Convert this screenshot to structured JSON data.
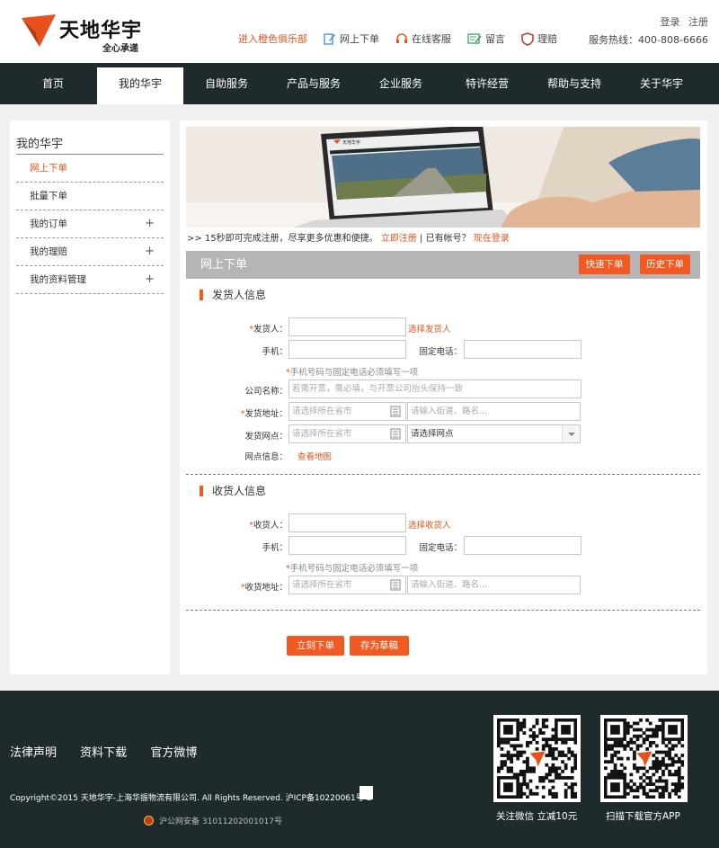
{
  "brand": {
    "name": "天地华宇",
    "slogan": "全心承递",
    "accent": "#f15a22"
  },
  "auth": {
    "login": "登录",
    "register": "注册"
  },
  "top_links": [
    {
      "label": "进入橙色俱乐部",
      "icon": "none"
    },
    {
      "label": "网上下单",
      "icon": "edit-icon"
    },
    {
      "label": "在线客服",
      "icon": "headset-icon"
    },
    {
      "label": "留言",
      "icon": "message-icon"
    },
    {
      "label": "理赔",
      "icon": "shield-icon"
    }
  ],
  "hotline": "服务热线：400-808-6666",
  "nav": [
    "首页",
    "我的华宇",
    "自助服务",
    "产品与服务",
    "企业服务",
    "特许经营",
    "帮助与支持",
    "关于华宇"
  ],
  "nav_active": "我的华宇",
  "sidebar": {
    "title": "我的华宇",
    "items": [
      {
        "label": "网上下单",
        "expandable": false,
        "active": true
      },
      {
        "label": "批量下单",
        "expandable": false,
        "active": false
      },
      {
        "label": "我的订单",
        "expandable": true,
        "active": false
      },
      {
        "label": "我的理赔",
        "expandable": true,
        "active": false
      },
      {
        "label": "我的资料管理",
        "expandable": true,
        "active": false
      }
    ],
    "expand_symbol": "+"
  },
  "banner": {
    "screen_brand": "天地华宇"
  },
  "register_line": {
    "prefix": ">> 15秒即可完成注册，尽享更多优惠和便捷。",
    "register_now": "立即注册",
    "separator": "| 已有帐号？",
    "login_now": "现在登录"
  },
  "order": {
    "title": "网上下单",
    "quick_btn": "快速下单",
    "history_btn": "历史下单"
  },
  "sender": {
    "section_title": "发货人信息",
    "name_label": "发货人：",
    "name_link": "选择发货人",
    "mobile_label": "手机：",
    "phone_label": "固定电话：",
    "hint": "手机号码与固定电话必须填写一项",
    "company_label": "公司名称：",
    "company_placeholder": "若需开票，需必填，与开票公司抬头保持一致",
    "address_label": "发货地址：",
    "city_placeholder": "请选择所在省市",
    "street_placeholder": "请输入街道、路名...",
    "outlet_label": "发货网点：",
    "outlet_city_placeholder": "请选择所在省市",
    "outlet_select": "请选择网点",
    "outlet_info_label": "网点信息：",
    "map_link": "查看地图"
  },
  "receiver": {
    "section_title": "收货人信息",
    "name_label": "收货人：",
    "name_link": "选择收货人",
    "mobile_label": "手机：",
    "phone_label": "固定电话：",
    "hint": "手机号码与固定电话必须填写一项",
    "address_label": "收货地址：",
    "city_placeholder": "请选择所在省市",
    "street_placeholder": "请输入街道、路名..."
  },
  "required_mark": "*",
  "actions": {
    "submit": "立刻下单",
    "draft": "存为草稿"
  },
  "footer": {
    "links": [
      "法律声明",
      "资料下载",
      "官方微博"
    ],
    "copyright": "Copyright©2015 天地华宇-上海华振物流有限公司. All Rights Reserved. 沪ICP备10220061号-2",
    "police": "沪公网安备 31011202001017号",
    "qr_wechat": "关注微信 立减10元",
    "qr_app": "扫描下载官方APP"
  }
}
